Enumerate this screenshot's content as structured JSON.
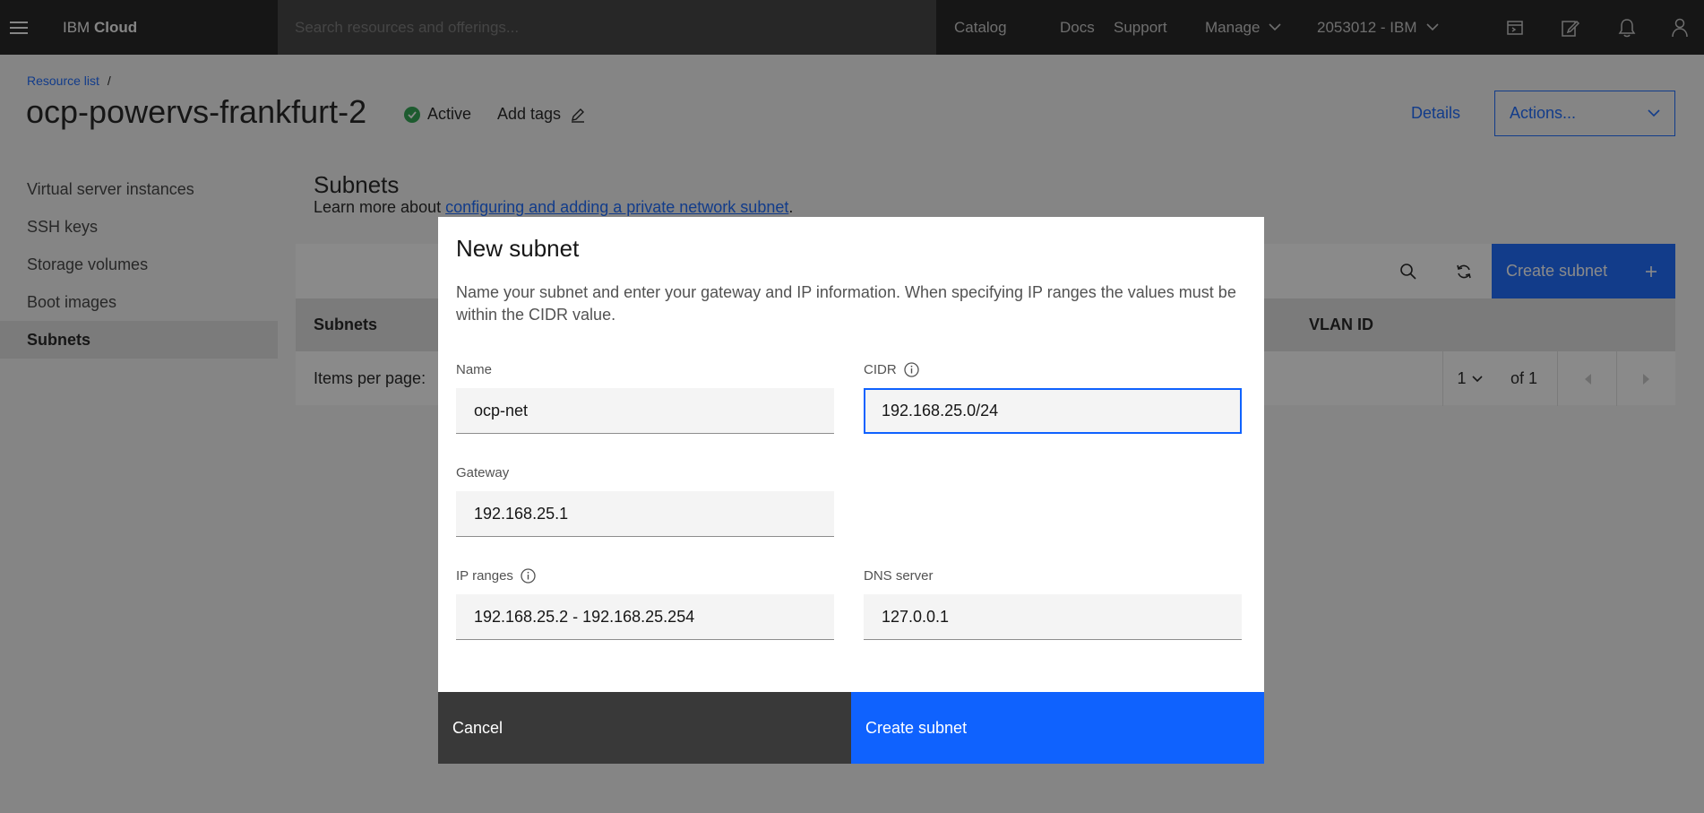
{
  "header": {
    "brand_prefix": "IBM",
    "brand_name": "Cloud",
    "search_placeholder": "Search resources and offerings...",
    "nav": [
      "Catalog",
      "Docs",
      "Support",
      "Manage"
    ],
    "account": "2053012 - IBM"
  },
  "page": {
    "breadcrumb": "Resource list",
    "breadcrumb_sep": "/",
    "title": "ocp-powervs-frankfurt-2",
    "status": "Active",
    "add_tags": "Add tags",
    "details": "Details",
    "actions": "Actions..."
  },
  "sidebar": {
    "items": [
      {
        "label": "Virtual server instances"
      },
      {
        "label": "SSH keys"
      },
      {
        "label": "Storage volumes"
      },
      {
        "label": "Boot images"
      },
      {
        "label": "Subnets"
      }
    ]
  },
  "section": {
    "title": "Subnets",
    "desc_prefix": "Learn more about ",
    "desc_link": "configuring and adding a private network subnet",
    "desc_suffix": "."
  },
  "table": {
    "create_label": "Create subnet",
    "columns": [
      "Subnets",
      "VLAN ID"
    ],
    "items_per_page": "Items per page:",
    "page_number": "1",
    "of_pages": "of 1"
  },
  "modal": {
    "title": "New subnet",
    "description": "Name your subnet and enter your gateway and IP information. When specifying IP ranges the values must be within the CIDR value.",
    "fields": {
      "name": {
        "label": "Name",
        "value": "ocp-net"
      },
      "cidr": {
        "label": "CIDR",
        "value": "192.168.25.0/24"
      },
      "gateway": {
        "label": "Gateway",
        "value": "192.168.25.1"
      },
      "ip_ranges": {
        "label": "IP ranges",
        "value": "192.168.25.2 - 192.168.25.254"
      },
      "dns": {
        "label": "DNS server",
        "value": "127.0.0.1"
      }
    },
    "cancel": "Cancel",
    "create": "Create subnet"
  },
  "colors": {
    "primary": "#0f62fe",
    "header_bg": "#161616",
    "success": "#24a148"
  }
}
